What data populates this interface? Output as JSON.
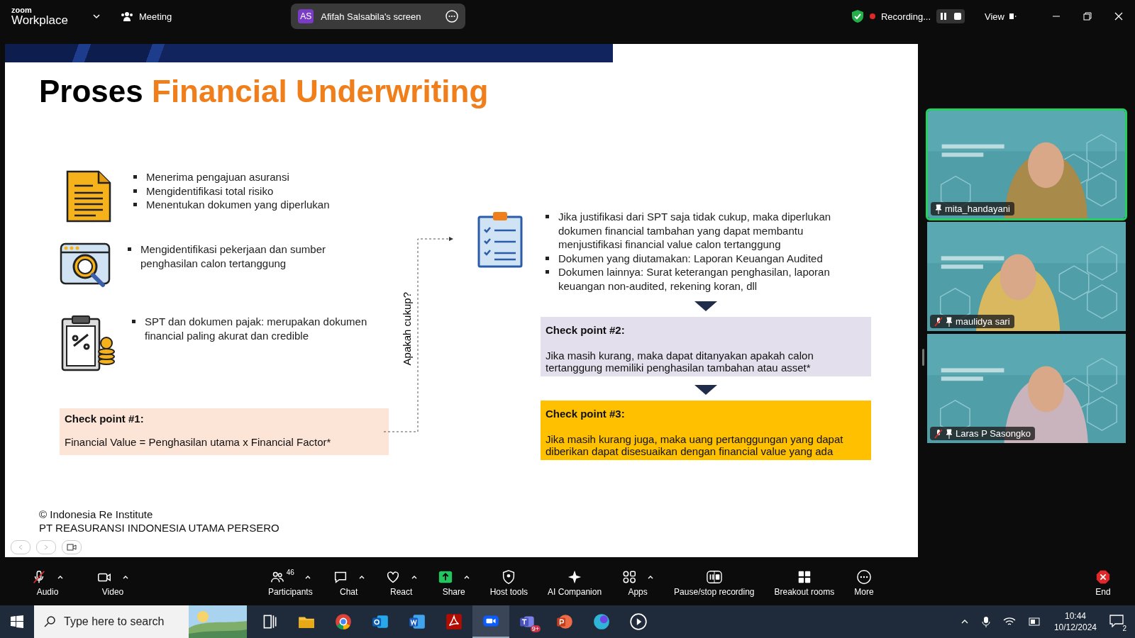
{
  "topbar": {
    "brand_small": "zoom",
    "brand": "Workplace",
    "meeting_label": "Meeting",
    "share_initials": "AS",
    "share_title": "Afifah Salsabila's screen",
    "recording_label": "Recording...",
    "view_label": "View"
  },
  "slide": {
    "title_plain": "Proses",
    "title_accent": "Financial Underwriting",
    "steps": [
      {
        "bullets": [
          "Menerima pengajuan asuransi",
          "Mengidentifikasi total risiko",
          "Menentukan dokumen yang diperlukan"
        ]
      },
      {
        "bullets": [
          "Mengidentifikasi pekerjaan dan sumber penghasilan calon tertanggung"
        ]
      },
      {
        "bullets": [
          "SPT dan dokumen pajak: merupakan dokumen financial paling akurat dan credible"
        ]
      }
    ],
    "checkpoint1": {
      "title": "Check point #1:",
      "text": "Financial Value = Penghasilan utama x Financial Factor*",
      "color": "#fce4d6"
    },
    "question": "Apakah cukup?",
    "extra_bullets": [
      "Jika justifikasi dari SPT saja tidak cukup, maka diperlukan dokumen financial tambahan yang dapat membantu menjustifikasi financial value calon tertanggung",
      "Dokumen yang diutamakan: Laporan Keuangan Audited",
      "Dokumen lainnya: Surat keterangan penghasilan, laporan keuangan non-audited, rekening koran, dll"
    ],
    "checkpoints": [
      {
        "title": "Check point #2:",
        "text": "Jika masih kurang, maka dapat ditanyakan apakah calon tertanggung memiliki penghasilan tambahan atau asset*",
        "color": "#e4dfec"
      },
      {
        "title": "Check point #3:",
        "text": "Jika masih kurang juga, maka uang pertanggungan yang dapat diberikan dapat disesuaikan dengan financial value yang ada",
        "color": "#ffc000"
      }
    ],
    "footer": [
      "© Indonesia Re Institute",
      "PT REASURANSI INDONESIA UTAMA PERSERO"
    ]
  },
  "participants": [
    {
      "name": "mita_handayani",
      "speaking": true,
      "muted": false
    },
    {
      "name": "maulidya sari",
      "speaking": false,
      "muted": true
    },
    {
      "name": "Laras P Sasongko",
      "speaking": false,
      "muted": true
    }
  ],
  "toolbar": [
    {
      "kind": "audio",
      "label": "Audio",
      "caret": true
    },
    {
      "kind": "video",
      "label": "Video",
      "caret": true
    },
    {
      "kind": "participants",
      "label": "Participants",
      "count": "46",
      "caret": true
    },
    {
      "kind": "chat",
      "label": "Chat",
      "caret": true
    },
    {
      "kind": "react",
      "label": "React",
      "caret": true
    },
    {
      "kind": "share",
      "label": "Share",
      "caret": true
    },
    {
      "kind": "host",
      "label": "Host tools",
      "caret": false
    },
    {
      "kind": "ai",
      "label": "AI Companion",
      "caret": false
    },
    {
      "kind": "apps",
      "label": "Apps",
      "caret": true
    },
    {
      "kind": "record",
      "label": "Pause/stop recording",
      "caret": false
    },
    {
      "kind": "breakout",
      "label": "Breakout rooms",
      "caret": false
    },
    {
      "kind": "more",
      "label": "More",
      "caret": false
    },
    {
      "kind": "end",
      "label": "End",
      "caret": false
    }
  ],
  "taskbar": {
    "search_placeholder": "Type here to search",
    "apps": [
      {
        "kind": "taskview",
        "selected": false
      },
      {
        "kind": "explorer",
        "selected": false
      },
      {
        "kind": "chrome",
        "selected": false
      },
      {
        "kind": "outlook",
        "selected": false
      },
      {
        "kind": "word",
        "selected": false
      },
      {
        "kind": "acrobat",
        "selected": false
      },
      {
        "kind": "zoom",
        "selected": true
      },
      {
        "kind": "teams",
        "selected": false,
        "badge": "9+"
      },
      {
        "kind": "powerpoint",
        "selected": false
      },
      {
        "kind": "canva",
        "selected": false
      },
      {
        "kind": "player",
        "selected": false
      }
    ],
    "time": "10:44",
    "date": "10/12/2024",
    "notifications": "2"
  }
}
